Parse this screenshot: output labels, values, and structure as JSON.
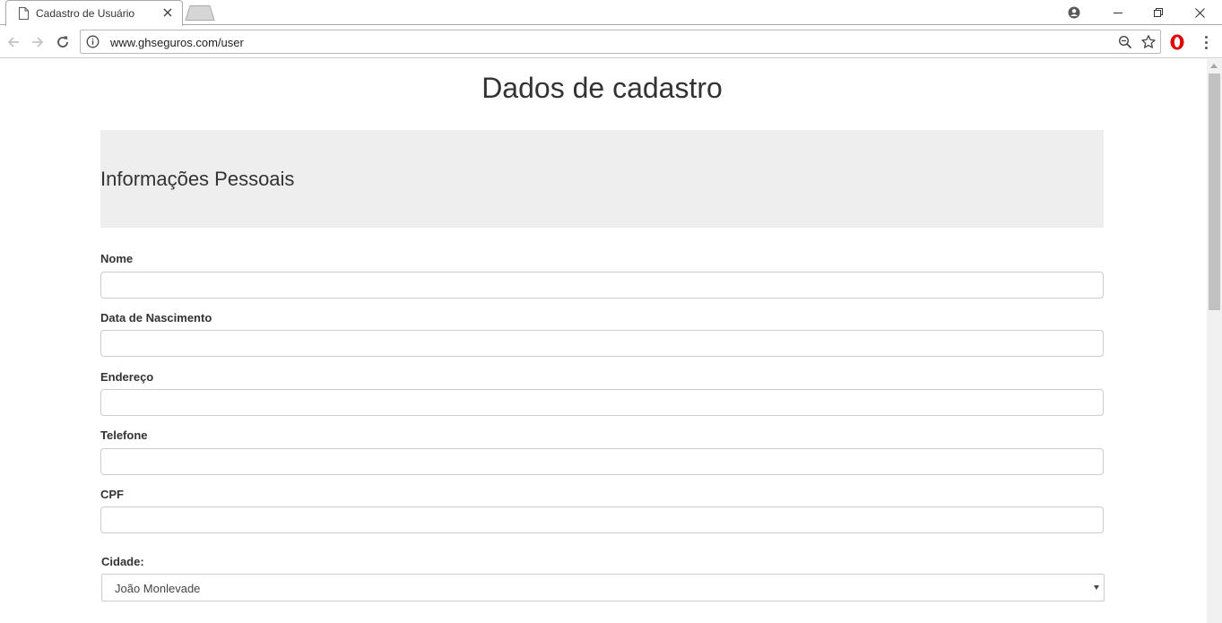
{
  "browser": {
    "tab_title": "Cadastro de Usuário",
    "url": "www.ghseguros.com/user"
  },
  "page": {
    "title": "Dados de cadastro",
    "section_title": "Informações Pessoais",
    "fields": {
      "nome": {
        "label": "Nome",
        "value": ""
      },
      "nascimento": {
        "label": "Data de Nascimento",
        "value": ""
      },
      "endereco": {
        "label": "Endereço",
        "value": ""
      },
      "telefone": {
        "label": "Telefone",
        "value": ""
      },
      "cpf": {
        "label": "CPF",
        "value": ""
      }
    },
    "cidade": {
      "label": "Cidade:",
      "selected": "João Monlevade"
    }
  },
  "colors": {
    "section_background": "#eeeeee",
    "input_border": "#cccccc",
    "text": "#333333",
    "opera_red": "#e00000"
  },
  "icons": [
    "page-icon",
    "tab-close-icon",
    "profile-icon",
    "minimize-icon",
    "restore-icon",
    "close-window-icon",
    "back-icon",
    "forward-icon",
    "reload-icon",
    "info-icon",
    "zoom-icon",
    "star-icon",
    "opera-icon",
    "menu-icon"
  ]
}
